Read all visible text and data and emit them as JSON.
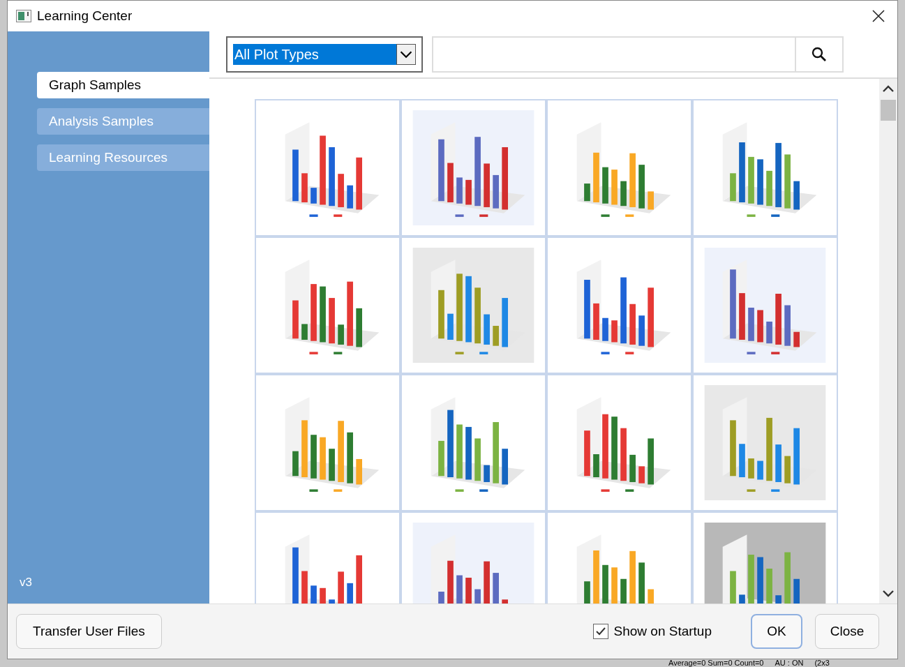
{
  "window": {
    "title": "Learning Center"
  },
  "sidebar": {
    "items": [
      {
        "label": "Graph Samples",
        "selected": true
      },
      {
        "label": "Analysis Samples",
        "selected": false
      },
      {
        "label": "Learning Resources",
        "selected": false
      }
    ],
    "version": "v3"
  },
  "filter": {
    "value": "All Plot Types"
  },
  "footer": {
    "transfer_button": "Transfer User Files",
    "show_on_startup": {
      "label": "Show on Startup",
      "checked": true
    },
    "buttons": [
      "OK",
      "Close"
    ]
  },
  "background_status": [
    "Average=0 Sum=0 Count=0",
    "AU : ON",
    "(2x3"
  ]
}
